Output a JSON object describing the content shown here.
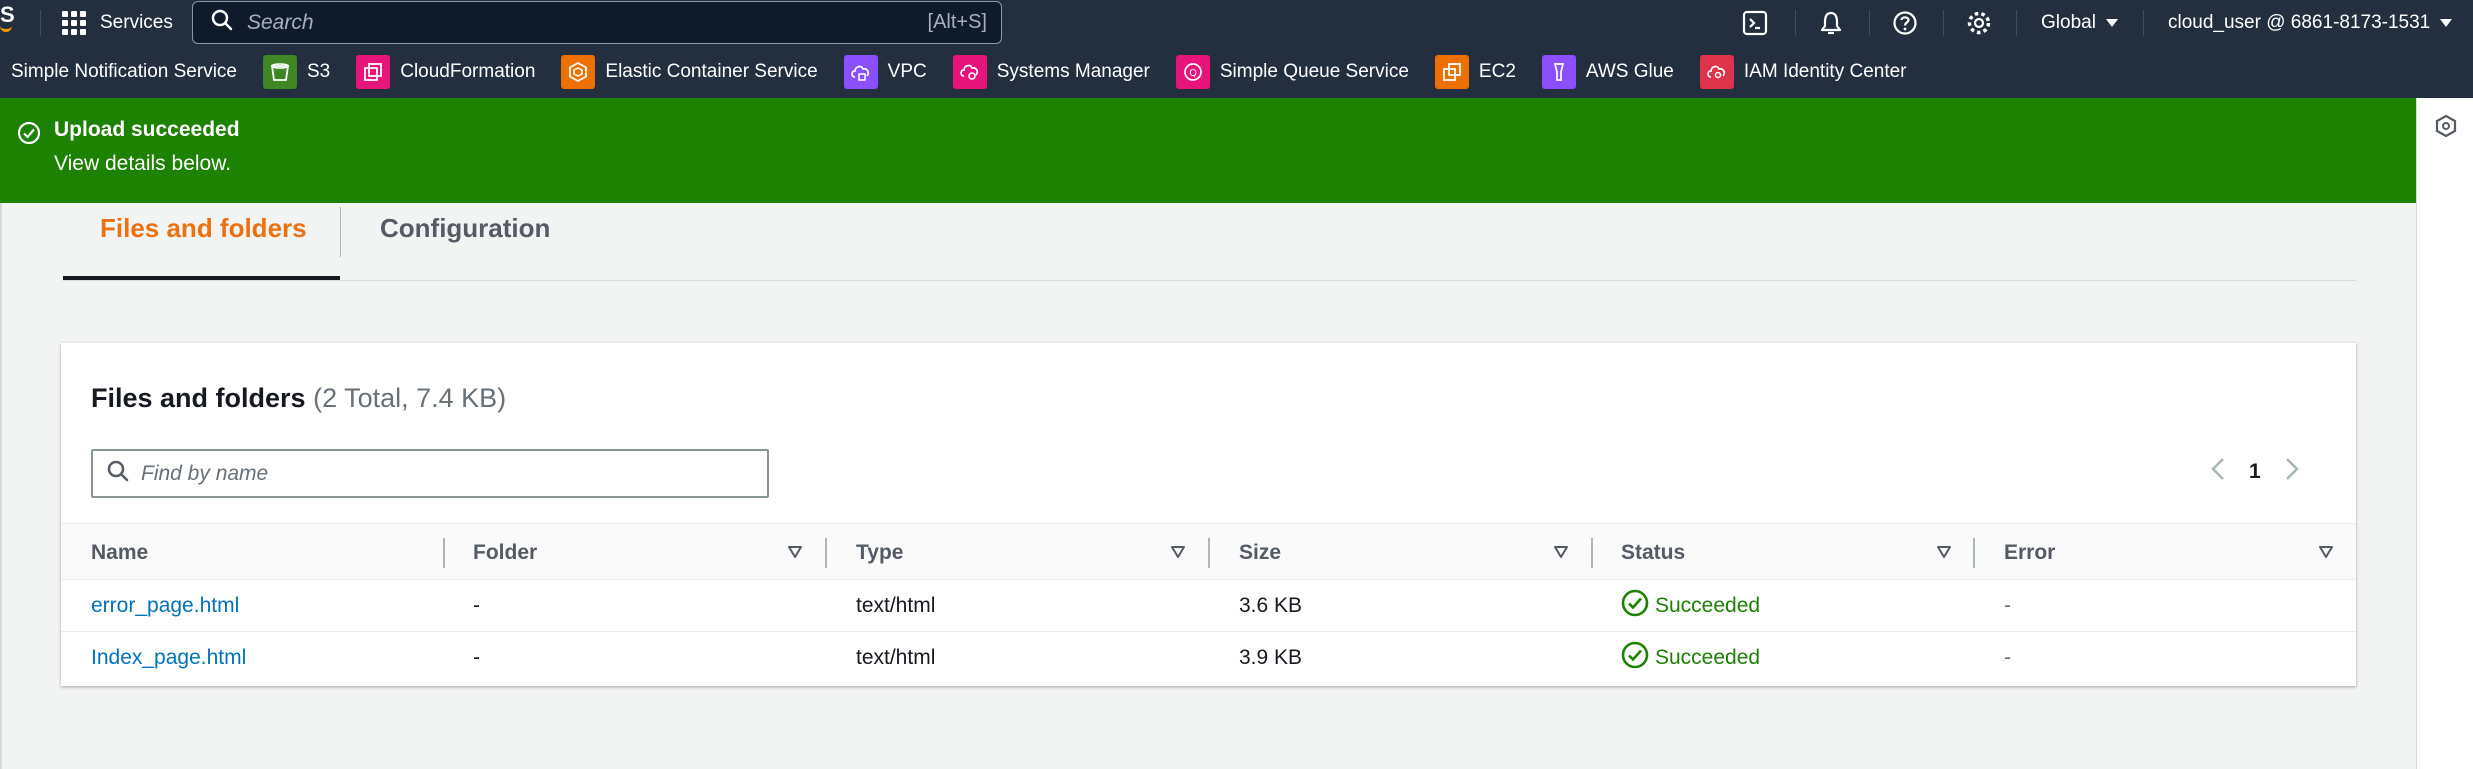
{
  "nav": {
    "logo_fragment": "S",
    "services_label": "Services",
    "search_placeholder": "Search",
    "search_shortcut": "[Alt+S]",
    "region": "Global",
    "account": "cloud_user @ 6861-8173-1531"
  },
  "favorites": [
    {
      "label": "Simple Notification Service",
      "icon": "sns-icon",
      "color": "#e7157b"
    },
    {
      "label": "S3",
      "icon": "bucket-icon",
      "color": "#3f8624"
    },
    {
      "label": "CloudFormation",
      "icon": "stack-icon",
      "color": "#e7157b"
    },
    {
      "label": "Elastic Container Service",
      "icon": "container-icon",
      "color": "#ed7100"
    },
    {
      "label": "VPC",
      "icon": "cloud-lock-icon",
      "color": "#8c4fff"
    },
    {
      "label": "Systems Manager",
      "icon": "gear-cloud-icon",
      "color": "#e7157b"
    },
    {
      "label": "Simple Queue Service",
      "icon": "queue-icon",
      "color": "#e7157b"
    },
    {
      "label": "EC2",
      "icon": "compute-icon",
      "color": "#ed7100"
    },
    {
      "label": "AWS Glue",
      "icon": "glue-icon",
      "color": "#8c4fff"
    },
    {
      "label": "IAM Identity Center",
      "icon": "identity-icon",
      "color": "#dd344c"
    }
  ],
  "flash": {
    "title": "Upload succeeded",
    "body": "View details below.",
    "color": "#1d8102"
  },
  "tabs": [
    {
      "label": "Files and folders",
      "active": true
    },
    {
      "label": "Configuration",
      "active": false
    }
  ],
  "panel": {
    "title": "Files and folders",
    "count": "(2 Total, 7.4 KB)",
    "search_placeholder": "Find by name",
    "page": "1"
  },
  "table": {
    "columns": [
      "Name",
      "Folder",
      "Type",
      "Size",
      "Status",
      "Error"
    ],
    "rows": [
      {
        "name": "error_page.html",
        "folder": "-",
        "type": "text/html",
        "size": "3.6 KB",
        "status": "Succeeded",
        "error": "-"
      },
      {
        "name": "Index_page.html",
        "folder": "-",
        "type": "text/html",
        "size": "3.9 KB",
        "status": "Succeeded",
        "error": "-"
      }
    ]
  }
}
